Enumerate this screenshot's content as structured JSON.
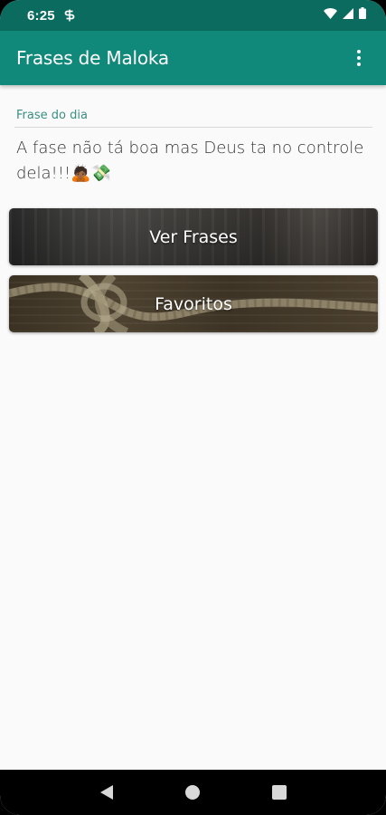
{
  "status_bar": {
    "time": "6:25"
  },
  "app_bar": {
    "title": "Frases de Maloka",
    "menu_icon": "more-vert-icon"
  },
  "quote": {
    "label": "Frase do dia",
    "text": "A fase não tá boa mas Deus ta no controle dela!!!🙇🏾💸"
  },
  "buttons": {
    "ver_frases": "Ver Frases",
    "favoritos": "Favoritos"
  },
  "nav": {
    "back_icon": "back-triangle-icon",
    "home_icon": "home-circle-icon",
    "recents_icon": "recents-square-icon"
  },
  "colors": {
    "status_bar": "#0b6b5e",
    "app_bar": "#11897a",
    "accent_label": "#3a8f83",
    "background": "#fafafa"
  }
}
